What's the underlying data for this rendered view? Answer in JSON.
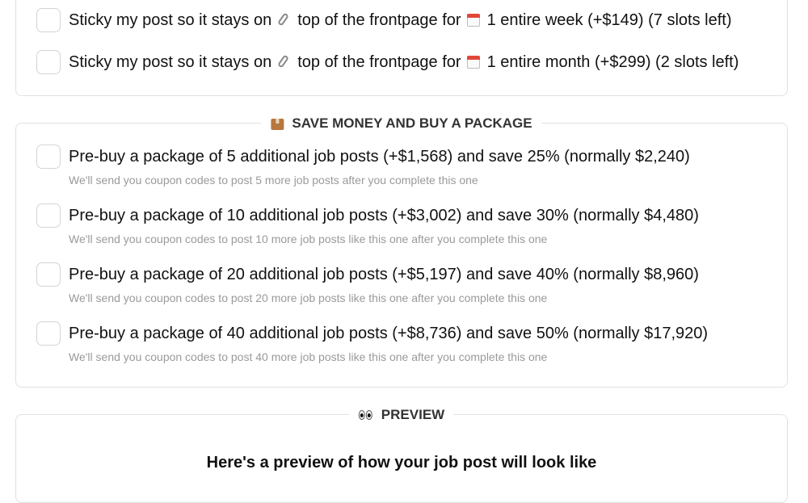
{
  "sticky_options": [
    {
      "part1": "Sticky my post so it stays on",
      "part2": "top of the frontpage for",
      "part3": "1 entire week (+$149) (7 slots left)",
      "icon1": "paperclip-icon",
      "icon2": "calendar-icon"
    },
    {
      "part1": "Sticky my post so it stays on",
      "part2": "top of the frontpage for",
      "part3": "1 entire month (+$299) (2 slots left)",
      "icon1": "paperclip-icon",
      "icon2": "calendar-icon"
    }
  ],
  "packages": {
    "title": "SAVE MONEY AND BUY A PACKAGE",
    "icon": "package-icon",
    "items": [
      {
        "label": "Pre-buy a package of 5 additional job posts (+$1,568) and save 25% (normally $2,240)",
        "hint": "We'll send you coupon codes to post 5 more job posts after you complete this one"
      },
      {
        "label": "Pre-buy a package of 10 additional job posts (+$3,002) and save 30% (normally $4,480)",
        "hint": "We'll send you coupon codes to post 10 more job posts like this one after you complete this one"
      },
      {
        "label": "Pre-buy a package of 20 additional job posts (+$5,197) and save 40% (normally $8,960)",
        "hint": "We'll send you coupon codes to post 20 more job posts like this one after you complete this one"
      },
      {
        "label": "Pre-buy a package of 40 additional job posts (+$8,736) and save 50% (normally $17,920)",
        "hint": "We'll send you coupon codes to post 40 more job posts like this one after you complete this one"
      }
    ]
  },
  "preview": {
    "title": "PREVIEW",
    "icon": "eyes-icon",
    "heading": "Here's a preview of how your job post will look like"
  },
  "colors": {
    "border": "#e1e1e1",
    "text": "#111111",
    "hint": "#9a9a9a",
    "checkbox_border": "#d4d4d4"
  }
}
